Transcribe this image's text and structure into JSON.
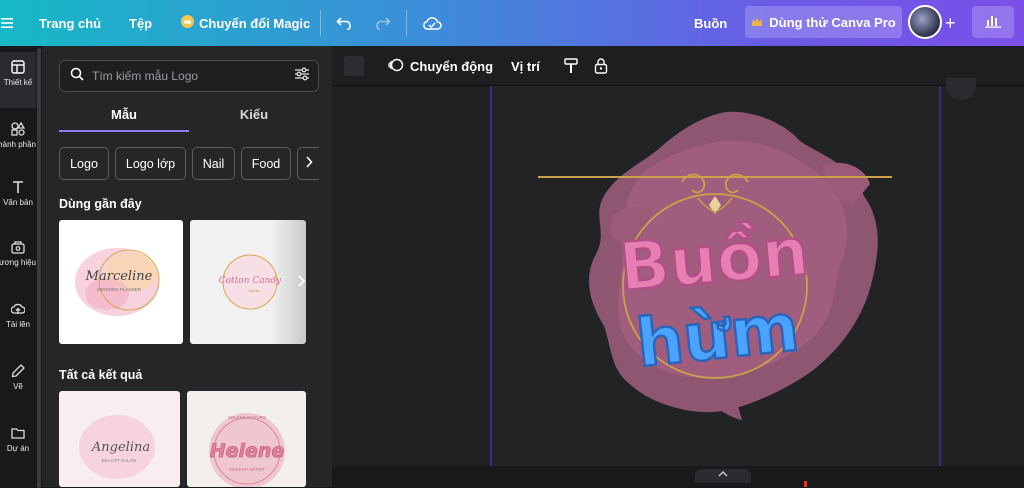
{
  "topbar": {
    "menu_icon": "hamburger-icon",
    "home": "Trang chủ",
    "file": "Tệp",
    "magic": "Chuyển đổi Magic",
    "undo_icon": "undo-icon",
    "redo_icon": "redo-icon",
    "cloud_icon": "cloud-save-icon",
    "doc_title": "Buồn",
    "pro_button": "Dùng thử Canva Pro",
    "add_icon": "plus-icon",
    "stats_icon": "bar-chart-icon"
  },
  "rail": {
    "items": [
      {
        "label": "Thiết kế",
        "icon": "layout-icon"
      },
      {
        "label": "Thành phần",
        "icon": "shapes-icon"
      },
      {
        "label": "Văn bản",
        "icon": "text-icon"
      },
      {
        "label": "Thương hiệu",
        "icon": "brand-icon"
      },
      {
        "label": "Tải lên",
        "icon": "upload-icon"
      },
      {
        "label": "Vẽ",
        "icon": "draw-icon"
      },
      {
        "label": "Dự án",
        "icon": "folder-icon"
      }
    ]
  },
  "panel": {
    "search_placeholder": "Tìm kiếm mẫu Logo",
    "tabs": [
      "Mẫu",
      "Kiểu"
    ],
    "chips": [
      "Logo",
      "Logo lớp",
      "Nail",
      "Food"
    ],
    "recent_title": "Dùng gần đây",
    "all_title": "Tất cả kết quả",
    "recent": [
      {
        "main": "Marceline",
        "sub": "WEDDING PLANNER"
      },
      {
        "main": "Cotton Candy",
        "sub": "Studio"
      }
    ],
    "results": [
      {
        "main": "Angelina",
        "sub": "BEAUTY SALON"
      },
      {
        "main": "Helene",
        "top": "HELENE PAGURS",
        "sub": "MAKEUP ARTIST"
      }
    ]
  },
  "toolbar": {
    "animate": "Chuyển động",
    "position": "Vị trí"
  },
  "design": {
    "line1": "Buồn",
    "line2": "hừm"
  },
  "colors": {
    "accent": "#8b7cf6",
    "title_pink": "#e77fb3",
    "title_blue": "#4aa3ff",
    "gold": "#c9a24a"
  }
}
